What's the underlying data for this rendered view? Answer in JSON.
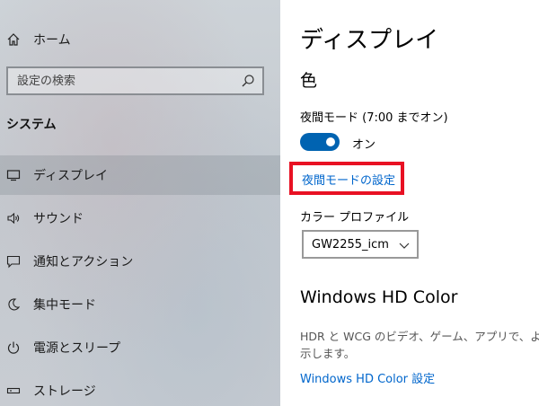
{
  "sidebar": {
    "home_label": "ホーム",
    "search_placeholder": "設定の検索",
    "section_title": "システム",
    "items": [
      {
        "label": "ディスプレイ",
        "icon": "monitor-icon",
        "selected": true
      },
      {
        "label": "サウンド",
        "icon": "speaker-icon"
      },
      {
        "label": "通知とアクション",
        "icon": "notification-icon"
      },
      {
        "label": "集中モード",
        "icon": "moon-icon"
      },
      {
        "label": "電源とスリープ",
        "icon": "power-icon"
      },
      {
        "label": "ストレージ",
        "icon": "storage-icon"
      }
    ]
  },
  "main": {
    "title": "ディスプレイ",
    "color_heading": "色",
    "night_light_label": "夜間モード (7:00 までオン)",
    "night_light_toggle_state": "オン",
    "night_light_settings_link": "夜間モードの設定",
    "color_profile_label": "カラー プロファイル",
    "color_profile_value": "GW2255_icm",
    "hd_color_heading": "Windows HD Color",
    "hd_color_desc": "HDR と WCG のビデオ、ゲーム、アプリで、より",
    "hd_color_desc2": "示します。",
    "hd_color_link": "Windows HD Color 設定"
  },
  "colors": {
    "accent": "#0063b1",
    "link": "#0066cc",
    "highlight": "#e81123"
  }
}
